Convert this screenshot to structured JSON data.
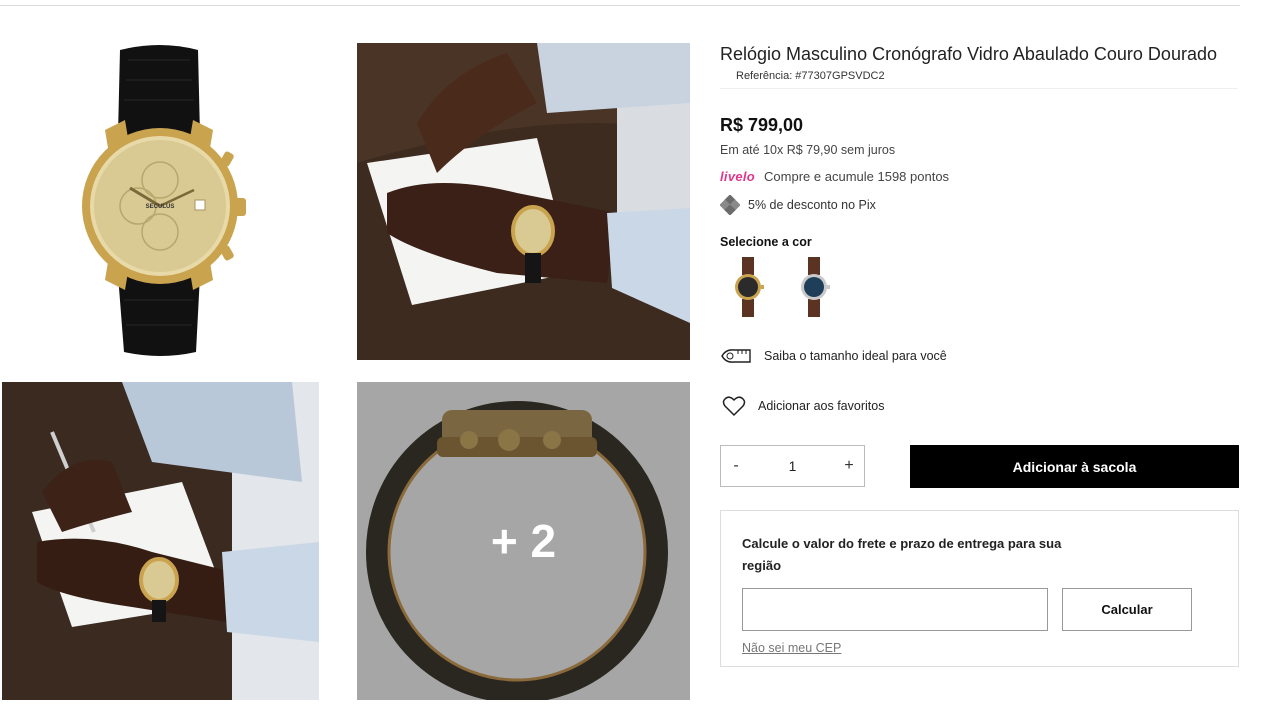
{
  "product": {
    "title": "Relógio Masculino Cronógrafo Vidro Abaulado Couro Dourado",
    "reference": "Referência: #77307GPSVDC2",
    "price": "R$ 799,00",
    "installments": "Em até 10x R$ 79,90 sem juros",
    "livelo_logo": "livelo",
    "livelo_text": "Compre e acumule 1598 pontos",
    "pix_text": "5% de desconto no Pix"
  },
  "gallery": {
    "more_label": "+ 2",
    "brand_on_dial": "SECULUS"
  },
  "colors": {
    "label": "Selecione a cor",
    "options": [
      {
        "name": "brown-black-dial",
        "dial": "#2b2b2b",
        "strap": "#5a3322"
      },
      {
        "name": "brown-blue-dial",
        "dial": "#1e3e5a",
        "strap": "#5a3322"
      }
    ]
  },
  "size_guide": "Saiba o tamanho ideal para você",
  "favorites": "Adicionar aos favoritos",
  "quantity": {
    "minus": "-",
    "value": "1",
    "plus": "+"
  },
  "add_to_bag": "Adicionar à sacola",
  "shipping": {
    "title": "Calcule o valor do frete e prazo de entrega para sua região",
    "input_value": "",
    "calc_label": "Calcular",
    "unknown_cep": "Não sei meu CEP"
  },
  "accent_colors": {
    "livelo": "#e0378e",
    "button": "#000000"
  }
}
